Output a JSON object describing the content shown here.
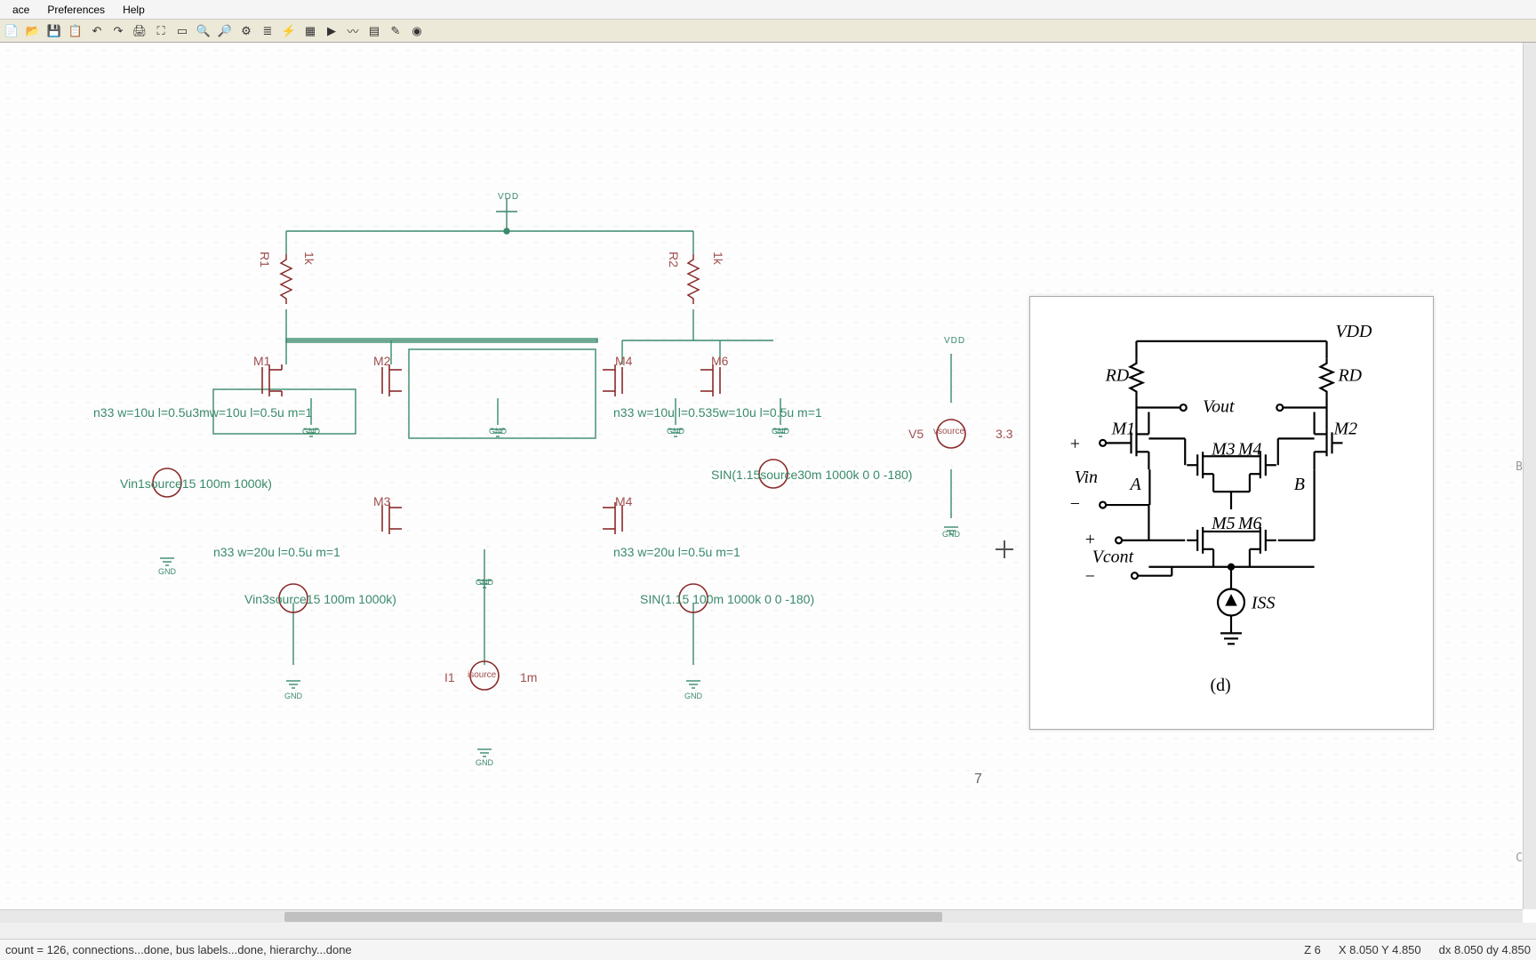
{
  "menu": {
    "items": [
      "ace",
      "Preferences",
      "Help"
    ]
  },
  "toolbar": {
    "icons": [
      "new-icon",
      "open-icon",
      "save-icon",
      "print-icon",
      "undo-icon",
      "redo-icon",
      "fit-icon",
      "zoom-rect-icon",
      "zoom-in-icon",
      "zoom-out-icon",
      "find-icon",
      "sheet-icon",
      "layers-icon",
      "grid-icon",
      "snap-icon",
      "netlist-icon",
      "erc-icon",
      "annotate-icon",
      "sim-icon",
      "wave-icon"
    ]
  },
  "transistors": {
    "M1": "M1",
    "M2": "M2",
    "M3": "M3",
    "M4": "M4",
    "M6": "M6"
  },
  "resistors": {
    "R1": "R1",
    "R2": "R2",
    "val": "1k"
  },
  "params": {
    "m1": "n33 w=10u l=0.5u3mw=10u l=0.5u m=1",
    "m4": "n33 w=10u l=0.535w=10u l=0.5u m=1",
    "m3": "n33 w=20u l=0.5u m=1",
    "m5": "n33 w=20u l=0.5u m=1"
  },
  "sources": {
    "vin1": "Vin1source15 100m 1000k)",
    "vin3": "Vin3source15 100m 1000k)",
    "vin2": "SIN(1.15source30m 1000k 0 0 -180)",
    "vin4": "SIN(1.15 100m 1000k 0 0 -180)",
    "v5": "V5",
    "v5val": "3.3",
    "vsource": "vsource",
    "i1": "I1",
    "isource": "isource",
    "i1val": "1m"
  },
  "nets": {
    "vdd": "VDD",
    "gnd": "GND"
  },
  "plain": {
    "seven": "7"
  },
  "ref": {
    "Vdd": "VDD",
    "Rd": "RD",
    "Vout": "Vout",
    "M1": "M1",
    "M2": "M2",
    "M3": "M3",
    "M4": "M4",
    "M5": "M5",
    "M6": "M6",
    "Vin": "Vin",
    "Vcont": "Vcont",
    "A": "A",
    "B": "B",
    "Iss": "ISS",
    "caption": "(d)"
  },
  "ruler": {
    "b": "B",
    "c": "C"
  },
  "status": {
    "left": "count = 126,  connections...done,  bus labels...done, hierarchy...done",
    "z": "Z 6",
    "xy": "X 8.050  Y 4.850",
    "dxy": "dx 8.050  dy 4.850"
  }
}
